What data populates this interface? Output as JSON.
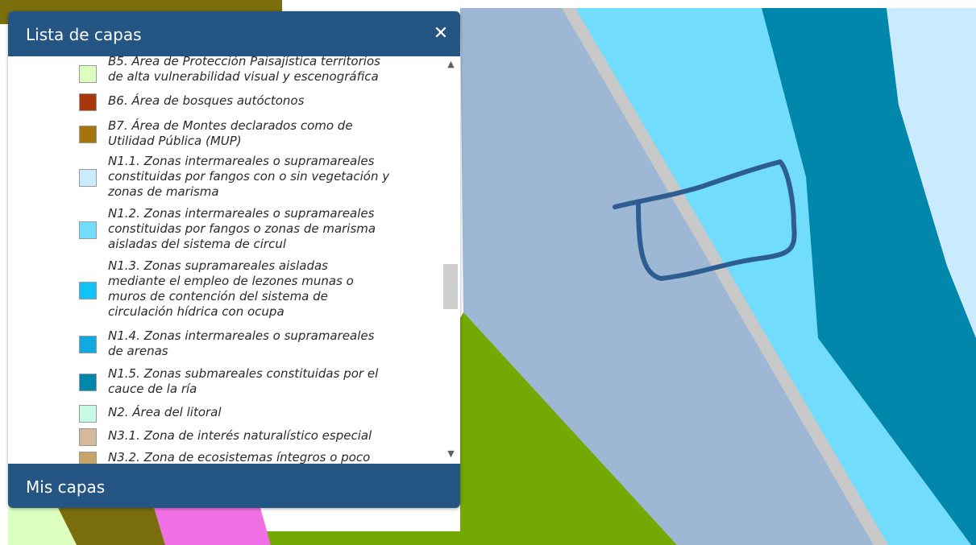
{
  "map": {
    "colors": {
      "background": "#ffffff",
      "lowland": "#9db7d5",
      "intertidal": "#71dcfb",
      "channel": "#0087ab",
      "upper_bank": "#c9ebfd",
      "road": "#c8c8c8",
      "green": "#72a902",
      "pink": "#f16fe5",
      "olive": "#7b6e0c",
      "pale_green": "#dcfebf",
      "drawing_outline": "#2d5d91"
    }
  },
  "panel": {
    "title": "Lista de capas",
    "close_icon": "✕",
    "footer_label": "Mis capas",
    "header_color": "#245583",
    "scroll_up_icon": "chevron-up-icon",
    "scroll_down_icon": "chevron-down-icon",
    "layers": [
      {
        "label": "B5. Área de Protección Paisajística territorios\nde alta vulnerabilidad visual y escenográfica",
        "color": "#dcfebf"
      },
      {
        "label": "B6. Área de bosques autóctonos",
        "color": "#a8380c"
      },
      {
        "label": "B7. Área de Montes declarados como de\nUtilidad Pública (MUP)",
        "color": "#a6740c"
      },
      {
        "label": "N1.1. Zonas intermareales o supramareales\nconstituidas por fangos con o sin vegetación y\nzonas de marisma",
        "color": "#c9ebfd"
      },
      {
        "label": "N1.2. Zonas intermareales o supramareales\nconstituidas por fangos o zonas de marisma\naisladas del sistema de circul",
        "color": "#71dcfb"
      },
      {
        "label": "N1.3. Zonas supramareales aisladas\nmediante el empleo de lezones munas o\nmuros de contención del sistema de\ncirculación hídrica con ocupa",
        "color": "#0fc3f6"
      },
      {
        "label": "N1.4. Zonas intermareales o supramareales\nde arenas",
        "color": "#12a8e2"
      },
      {
        "label": "N1.5. Zonas submareales constituidas por el\ncauce de la ría",
        "color": "#0087ab"
      },
      {
        "label": "N2. Área del litoral",
        "color": "#c5fbe5"
      },
      {
        "label": "N3.1. Zona de interés naturalístico especial",
        "color": "#d5b99d"
      },
      {
        "label": "N3.2. Zona de ecosistemas íntegros o poco",
        "color": "#c8a36a"
      }
    ]
  }
}
